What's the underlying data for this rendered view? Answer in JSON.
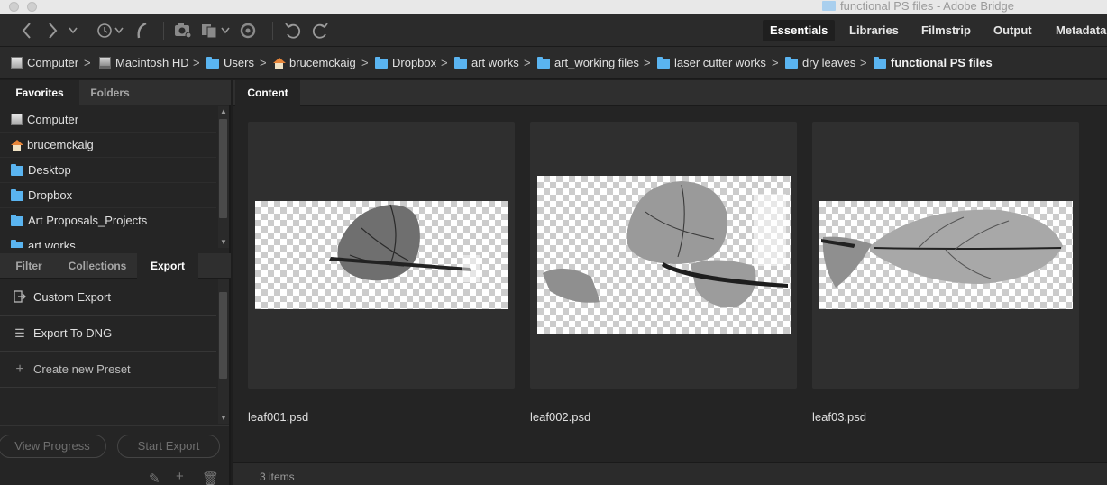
{
  "window": {
    "title": "functional PS files - Adobe Bridge"
  },
  "toolbar": {
    "icons": [
      "back-arrow-icon",
      "forward-arrow-icon",
      "dropdown-icon",
      "recent-history-icon",
      "reveal-icon",
      "camera-icon",
      "copy-icon",
      "refine-icon",
      "rotate-left-icon",
      "rotate-right-icon"
    ],
    "workspaces": [
      "Essentials",
      "Libraries",
      "Filmstrip",
      "Output",
      "Metadata"
    ],
    "active_workspace": "Essentials"
  },
  "breadcrumb": [
    {
      "label": "Computer",
      "icon": "drive-icon"
    },
    {
      "label": "Macintosh HD",
      "icon": "hard-disk-icon"
    },
    {
      "label": "Users",
      "icon": "folder-icon"
    },
    {
      "label": "brucemckaig",
      "icon": "home-icon"
    },
    {
      "label": "Dropbox",
      "icon": "folder-icon"
    },
    {
      "label": "art works",
      "icon": "folder-icon"
    },
    {
      "label": "art_working files",
      "icon": "folder-icon"
    },
    {
      "label": "laser cutter works",
      "icon": "folder-icon"
    },
    {
      "label": "dry leaves",
      "icon": "folder-icon"
    },
    {
      "label": "functional PS files",
      "icon": "folder-icon"
    }
  ],
  "top_panel": {
    "tabs": [
      "Favorites",
      "Folders"
    ],
    "active_tab": "Favorites",
    "items": [
      {
        "label": "Computer",
        "icon": "drive-icon"
      },
      {
        "label": "brucemckaig",
        "icon": "home-icon"
      },
      {
        "label": "Desktop",
        "icon": "folder-icon"
      },
      {
        "label": "Dropbox",
        "icon": "folder-icon"
      },
      {
        "label": "Art Proposals_Projects",
        "icon": "folder-icon"
      },
      {
        "label": "art works",
        "icon": "folder-icon"
      }
    ]
  },
  "bottom_panel": {
    "tabs": [
      "Filter",
      "Collections",
      "Export"
    ],
    "active_tab": "Export",
    "items": [
      {
        "label": "Custom Export",
        "icon": "export-icon"
      },
      {
        "label": "Export To DNG",
        "icon": "list-icon"
      },
      {
        "label": "Create new Preset",
        "icon": "plus-icon"
      }
    ],
    "buttons": [
      "View Progress",
      "Start Export"
    ],
    "footer_icons": [
      "pencil-icon",
      "plus-icon",
      "trash-icon"
    ]
  },
  "content": {
    "tab": "Content",
    "thumbnails": [
      {
        "filename": "leaf001.psd"
      },
      {
        "filename": "leaf002.psd"
      },
      {
        "filename": "leaf03.psd"
      }
    ],
    "status": "3 items"
  },
  "colors": {
    "accent_folder": "#5ab4f0",
    "panel_bg": "#252525",
    "toolbar_bg": "#2b2b2b"
  }
}
